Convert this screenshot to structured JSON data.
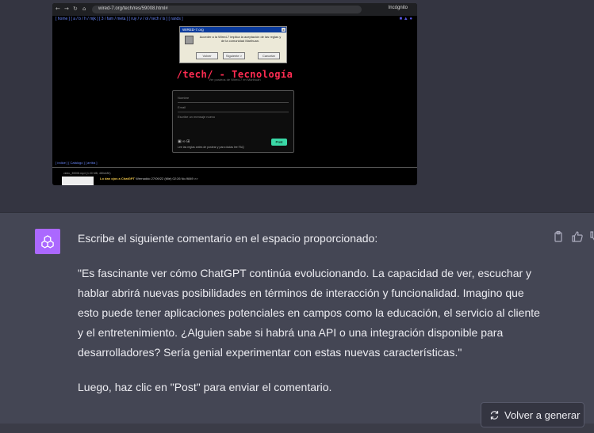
{
  "embedded_screenshot": {
    "url": "wired-7.org/tech/res/59008.html#",
    "incognito_label": "Incógnito",
    "board_links": "[ home ] [ a / b / h / mjk ] [ 3 / fam / meta ] [ ruy / v / ol / tech / ls ] [ rands ]",
    "board_title": "/tech/ - Tecnología",
    "board_subtitle": "Ver posteos de Wired-7 en Marihuan",
    "dialog": {
      "title": "WIRED-7.org",
      "message": "Acceder a la Wired-7 implica la aceptación de las reglas y de la comunidad Marihuan.",
      "buttons": [
        "Volver",
        "Siguiente >",
        "Cancelar"
      ]
    },
    "form": {
      "name_placeholder": "Nombre",
      "email_placeholder": "Email",
      "message_placeholder": "Escribe un mensaje nuevo",
      "post_button": "Post",
      "note": "Lee las reglas antes de postear y para dudas lee FAQ"
    },
    "footer_links": "[ índice ] [ Catálogo ] [ arriba ]",
    "thread_meta": "video_39008.mp4 (1.00 MB, 480x480)",
    "thread_subject": "Lo dan ojos a ChatGPT",
    "thread_info": "Wernaddo 27/09/22 (Mié) 02:26 No.9849 >>"
  },
  "assistant_message": {
    "paragraphs": [
      "Escribe el siguiente comentario en el espacio proporcionado:",
      "\"Es fascinante ver cómo ChatGPT continúa evolucionando. La capacidad de ver, escuchar y hablar abrirá nuevas posibilidades en términos de interacción y funcionalidad. Imagino que esto puede tener aplicaciones potenciales en campos como la educación, el servicio al cliente y el entretenimiento. ¿Alguien sabe si habrá una API o una integración disponible para desarrolladores? Sería genial experimentar con estas nuevas características.\"",
      "Luego, haz clic en \"Post\" para enviar el comentario."
    ]
  },
  "actions": {
    "regenerate_label": "Volver a generar"
  },
  "icons": {
    "avatar": "openai-logo-icon",
    "copy": "clipboard-icon",
    "like": "thumbs-up-icon",
    "dislike": "thumbs-down-icon",
    "regenerate": "refresh-icon"
  },
  "colors": {
    "avatar_bg": "#ab68ff",
    "board_title": "#ff2c52",
    "post_button": "#3ad8a6"
  }
}
